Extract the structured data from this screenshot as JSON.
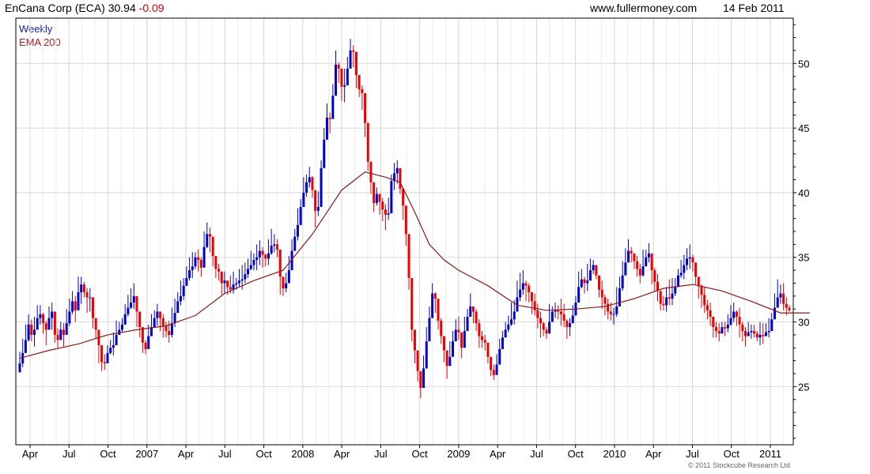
{
  "header": {
    "title": "EnCana Corp (ECA) 30.94",
    "change": "-0.09",
    "site": "www.fullermoney.com",
    "date": "14 Feb 2011"
  },
  "legend": {
    "weekly": "Weekly",
    "ema": "EMA 200"
  },
  "copyright": "© 2011 Stockcube Research Ltd",
  "colors": {
    "up": "#0000cc",
    "down": "#ee0000",
    "ema": "#8b1a1a",
    "grid": "#d8d8d8",
    "frame": "#000000"
  },
  "chart_data": {
    "type": "candlestick",
    "ylim": [
      20.5,
      53.5
    ],
    "yticks": [
      25,
      30,
      35,
      40,
      45,
      50
    ],
    "xlabels": [
      "Apr",
      "Jul",
      "Oct",
      "2007",
      "Apr",
      "Jul",
      "Oct",
      "2008",
      "Apr",
      "Jul",
      "Oct",
      "2009",
      "Apr",
      "Jul",
      "Oct",
      "2010",
      "Apr",
      "Jul",
      "Oct",
      "2011"
    ],
    "grid": true,
    "series": [
      {
        "name": "Weekly",
        "kind": "candles",
        "close": [
          26.8,
          27.6,
          28.6,
          29.8,
          29.0,
          29.4,
          30.3,
          30.6,
          29.9,
          29.4,
          30.3,
          30.8,
          29.0,
          28.6,
          29.4,
          29.0,
          29.9,
          30.8,
          31.6,
          30.9,
          32.3,
          32.9,
          32.3,
          31.9,
          31.9,
          30.3,
          29.4,
          28.2,
          26.9,
          26.8,
          27.6,
          28.0,
          28.2,
          29.0,
          29.4,
          29.8,
          30.6,
          31.1,
          31.5,
          32.0,
          30.8,
          29.6,
          28.4,
          27.9,
          28.9,
          29.6,
          30.3,
          30.8,
          30.3,
          29.7,
          29.3,
          29.0,
          29.9,
          30.7,
          31.6,
          32.0,
          32.8,
          33.4,
          34.0,
          34.3,
          35.0,
          34.8,
          34.2,
          35.8,
          36.8,
          36.6,
          35.1,
          34.1,
          33.9,
          33.0,
          33.2,
          32.7,
          32.5,
          32.9,
          33.0,
          33.2,
          33.3,
          33.7,
          34.1,
          34.4,
          34.8,
          35.0,
          35.5,
          35.2,
          34.9,
          35.3,
          35.9,
          36.0,
          35.6,
          33.5,
          32.6,
          33.0,
          34.0,
          35.5,
          36.6,
          37.5,
          38.9,
          40.0,
          40.8,
          41.2,
          40.2,
          38.6,
          38.9,
          41.9,
          44.1,
          45.8,
          45.7,
          47.5,
          49.9,
          49.6,
          48.2,
          48.3,
          49.6,
          51.0,
          50.9,
          49.1,
          48.0,
          47.7,
          45.4,
          42.4,
          40.8,
          39.2,
          39.9,
          39.3,
          38.7,
          38.3,
          38.4,
          40.9,
          41.5,
          41.9,
          40.3,
          39.0,
          36.8,
          33.4,
          29.4,
          27.8,
          26.2,
          24.9,
          26.4,
          28.5,
          30.3,
          32.2,
          31.8,
          30.1,
          28.9,
          27.8,
          26.6,
          27.3,
          28.5,
          29.4,
          29.2,
          28.0,
          29.3,
          30.4,
          31.2,
          30.8,
          29.9,
          28.9,
          28.6,
          28.4,
          27.3,
          26.3,
          25.9,
          26.7,
          27.9,
          28.8,
          29.4,
          29.8,
          30.2,
          30.8,
          31.9,
          32.5,
          33.0,
          32.8,
          32.3,
          31.6,
          30.9,
          30.3,
          29.9,
          29.4,
          29.1,
          30.0,
          30.8,
          30.9,
          30.8,
          30.6,
          30.1,
          29.6,
          29.9,
          30.5,
          31.5,
          32.7,
          33.3,
          33.0,
          33.2,
          34.0,
          34.4,
          33.6,
          32.5,
          31.9,
          31.4,
          30.8,
          30.6,
          30.6,
          31.2,
          32.6,
          33.6,
          34.6,
          35.5,
          35.3,
          34.7,
          34.1,
          33.6,
          34.3,
          35.0,
          35.3,
          34.0,
          33.1,
          32.4,
          31.4,
          31.3,
          31.9,
          31.8,
          32.2,
          32.7,
          33.6,
          33.8,
          34.4,
          34.9,
          35.0,
          34.6,
          33.5,
          32.8,
          32.1,
          31.3,
          30.9,
          30.4,
          29.6,
          29.3,
          29.1,
          29.6,
          29.5,
          29.8,
          30.3,
          30.8,
          30.4,
          29.8,
          29.3,
          28.9,
          29.2,
          29.3,
          29.1,
          28.8,
          29.0,
          28.9,
          29.2,
          29.3,
          30.2,
          31.1,
          31.9,
          32.2,
          31.4,
          31.1,
          30.9
        ],
        "high": [
          27.7,
          28.7,
          29.8,
          30.6,
          30.2,
          30.4,
          31.3,
          31.3,
          30.7,
          30.1,
          31.2,
          31.5,
          30.0,
          29.5,
          30.0,
          29.9,
          31.0,
          31.8,
          32.4,
          32.0,
          33.5,
          33.5,
          33.1,
          32.6,
          32.6,
          31.4,
          30.0,
          28.7,
          28.0,
          27.5,
          28.2,
          28.6,
          29.2,
          30.1,
          30.0,
          30.3,
          31.4,
          32.1,
          32.6,
          33.0,
          31.8,
          30.3,
          29.1,
          28.6,
          29.8,
          30.6,
          30.9,
          31.4,
          30.8,
          30.6,
          30.0,
          30.1,
          31.1,
          31.8,
          32.3,
          33.2,
          33.4,
          34.3,
          35.0,
          35.4,
          35.4,
          35.6,
          35.0,
          37.0,
          37.7,
          37.3,
          35.8,
          35.0,
          34.5,
          33.9,
          33.9,
          33.1,
          33.6,
          33.9,
          33.4,
          34.1,
          34.4,
          34.6,
          34.9,
          35.5,
          35.3,
          36.0,
          36.3,
          35.8,
          35.3,
          36.4,
          37.2,
          36.8,
          36.4,
          34.0,
          33.1,
          33.8,
          35.1,
          36.4,
          37.2,
          38.8,
          39.5,
          41.2,
          41.4,
          42.0,
          41.3,
          39.1,
          40.1,
          42.5,
          45.0,
          46.9,
          46.2,
          48.4,
          51.0,
          50.1,
          49.3,
          49.6,
          50.5,
          51.9,
          51.4,
          50.0,
          48.8,
          48.3,
          45.9,
          43.6,
          41.4,
          40.3,
          40.4,
          39.9,
          39.6,
          39.1,
          39.6,
          41.4,
          42.3,
          42.5,
          41.1,
          40.1,
          37.8,
          34.2,
          30.8,
          28.7,
          27.2,
          25.7,
          27.4,
          29.6,
          31.2,
          33.0,
          32.3,
          31.6,
          30.3,
          28.9,
          27.7,
          28.5,
          29.3,
          30.2,
          30.4,
          28.8,
          30.4,
          31.0,
          32.2,
          31.2,
          31.0,
          30.2,
          29.3,
          29.0,
          28.4,
          27.2,
          26.7,
          27.5,
          28.7,
          29.3,
          30.0,
          30.5,
          31.5,
          31.7,
          33.2,
          33.8,
          34.0,
          33.2,
          33.0,
          32.1,
          32.2,
          31.4,
          30.8,
          30.0,
          29.6,
          31.4,
          31.2,
          31.5,
          31.3,
          31.8,
          31.4,
          30.2,
          30.3,
          31.3,
          32.0,
          33.9,
          34.1,
          33.5,
          34.5,
          34.9,
          34.8,
          34.3,
          33.6,
          33.2,
          32.1,
          31.8,
          31.5,
          31.1,
          32.7,
          33.5,
          34.7,
          35.7,
          36.4,
          35.8,
          35.3,
          35.1,
          34.5,
          35.6,
          35.6,
          36.1,
          34.7,
          34.2,
          33.7,
          32.4,
          32.0,
          32.7,
          33.3,
          33.4,
          33.4,
          34.1,
          34.8,
          35.2,
          35.7,
          36.0,
          35.2,
          34.2,
          33.2,
          32.9,
          32.7,
          31.7,
          31.5,
          30.1,
          30.0,
          29.9,
          30.0,
          30.0,
          30.6,
          31.3,
          31.5,
          30.9,
          31.1,
          30.0,
          29.6,
          30.0,
          29.8,
          29.8,
          29.3,
          30.0,
          29.9,
          29.9,
          30.3,
          30.7,
          32.2,
          33.3,
          32.9,
          33.0,
          31.9,
          31.3
        ],
        "low": [
          26.1,
          26.5,
          28.1,
          28.5,
          28.5,
          28.1,
          29.5,
          29.8,
          29.1,
          28.2,
          29.6,
          29.4,
          28.4,
          28.0,
          28.7,
          28.1,
          29.4,
          29.7,
          30.6,
          30.0,
          31.2,
          31.4,
          31.9,
          30.7,
          30.8,
          29.5,
          28.7,
          26.8,
          26.2,
          26.3,
          26.9,
          27.5,
          27.4,
          28.7,
          29.1,
          29.2,
          29.8,
          30.4,
          31.0,
          31.0,
          29.6,
          28.8,
          27.6,
          27.5,
          28.0,
          29.2,
          29.6,
          29.7,
          29.3,
          28.8,
          28.8,
          28.4,
          28.8,
          29.6,
          30.7,
          31.3,
          31.7,
          32.8,
          33.2,
          33.4,
          34.1,
          33.9,
          33.5,
          34.5,
          35.7,
          35.4,
          34.3,
          33.4,
          33.2,
          32.1,
          32.2,
          32.1,
          32.2,
          32.2,
          32.5,
          32.7,
          32.5,
          33.0,
          33.4,
          34.0,
          34.0,
          34.0,
          34.4,
          34.2,
          34.3,
          34.4,
          35.2,
          35.4,
          35.0,
          32.1,
          32.0,
          32.3,
          33.2,
          34.6,
          35.9,
          36.3,
          37.8,
          38.9,
          39.7,
          40.4,
          39.6,
          37.3,
          38.2,
          40.7,
          43.3,
          44.7,
          44.6,
          46.9,
          49.2,
          48.5,
          47.1,
          47.0,
          48.8,
          49.7,
          49.7,
          48.1,
          47.4,
          46.4,
          44.3,
          41.7,
          39.9,
          38.5,
          39.0,
          38.3,
          37.8,
          37.1,
          37.9,
          40.2,
          40.2,
          40.7,
          39.9,
          37.9,
          35.9,
          32.5,
          28.5,
          26.8,
          25.4,
          24.1,
          25.8,
          27.7,
          29.0,
          31.1,
          30.7,
          29.4,
          28.3,
          26.9,
          25.6,
          26.7,
          27.5,
          28.6,
          28.6,
          27.2,
          28.1,
          29.5,
          30.5,
          29.9,
          29.3,
          28.0,
          28.0,
          27.8,
          26.8,
          25.8,
          25.5,
          25.9,
          27.3,
          27.9,
          28.9,
          29.2,
          29.7,
          29.8,
          30.9,
          31.6,
          32.1,
          31.6,
          31.5,
          30.6,
          30.5,
          29.5,
          28.8,
          28.9,
          28.7,
          29.3,
          30.2,
          30.3,
          30.2,
          29.7,
          29.6,
          28.7,
          28.9,
          30.0,
          30.6,
          31.9,
          32.6,
          32.2,
          32.4,
          33.3,
          33.7,
          33.3,
          31.9,
          31.0,
          30.5,
          30.2,
          30.1,
          29.8,
          30.4,
          31.8,
          32.4,
          33.7,
          34.9,
          34.6,
          34.1,
          33.5,
          33.0,
          33.5,
          34.4,
          34.6,
          32.9,
          32.4,
          31.6,
          30.9,
          30.9,
          30.8,
          31.3,
          31.3,
          32.0,
          32.8,
          33.4,
          33.3,
          34.0,
          34.1,
          33.9,
          32.9,
          31.8,
          31.1,
          30.7,
          30.2,
          29.7,
          28.8,
          28.8,
          28.5,
          29.3,
          28.9,
          29.2,
          29.7,
          30.0,
          29.7,
          28.8,
          28.5,
          28.1,
          28.9,
          28.7,
          28.8,
          28.5,
          28.2,
          28.3,
          28.9,
          28.8,
          29.3,
          30.5,
          31.3,
          31.4,
          30.9,
          30.5,
          30.8
        ],
        "notes": "weekly candles; open assumed equal to previous close"
      },
      {
        "name": "EMA 200",
        "kind": "line",
        "weeks": [
          0,
          10,
          20,
          30,
          40,
          50,
          60,
          70,
          80,
          90,
          100,
          110,
          118,
          125,
          130,
          135,
          140,
          145,
          150,
          160,
          170,
          180,
          190,
          200,
          210,
          220,
          230,
          240,
          250,
          260,
          270
        ],
        "values": [
          27.2,
          27.8,
          28.3,
          29.0,
          29.4,
          29.7,
          30.5,
          32.2,
          33.2,
          34.0,
          36.8,
          40.2,
          41.6,
          41.2,
          40.8,
          38.5,
          36.0,
          34.8,
          34.0,
          32.8,
          31.3,
          30.9,
          31.0,
          31.2,
          31.8,
          32.6,
          32.9,
          32.4,
          31.6,
          30.7,
          30.7
        ]
      }
    ]
  }
}
